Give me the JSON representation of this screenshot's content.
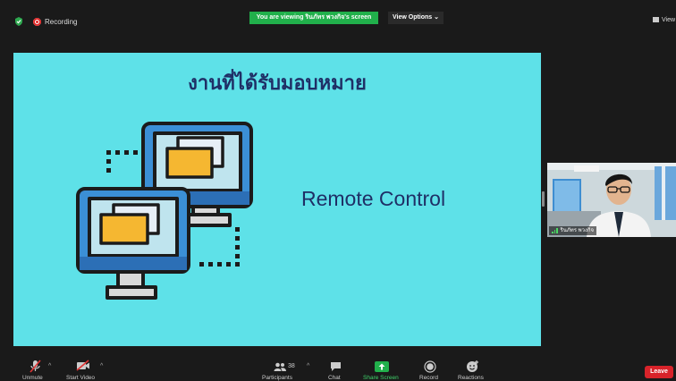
{
  "topbar": {
    "recording_label": "Recording",
    "viewing_banner": "You are viewing รินภัทร พวงกิจ's screen",
    "view_options_label": "View Options ⌄",
    "view_label": "View"
  },
  "slide": {
    "title": "งานที่ได้รับมอบหมาย",
    "text": "Remote Control"
  },
  "participant": {
    "name": "รินภัทร พวงกิจ"
  },
  "toolbar": {
    "unmute_label": "Unmute",
    "start_video_label": "Start Video",
    "participants_count": "38",
    "participants_label": "Participants",
    "chat_label": "Chat",
    "share_screen_label": "Share Screen",
    "record_label": "Record",
    "reactions_label": "Reactions",
    "leave_label": "Leave"
  },
  "colors": {
    "slide_bg": "#5ee1e8",
    "title": "#1f2f66",
    "share_green": "#21b04b",
    "leave_red": "#d8232a"
  }
}
